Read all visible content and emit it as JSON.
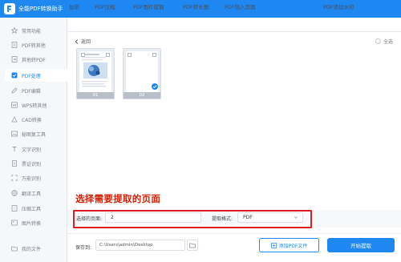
{
  "app": {
    "title": "全能PDF转换助手",
    "logo_icon": "pdf-logo-icon"
  },
  "colors": {
    "accent": "#1e87f0",
    "annotation": "#d81e06",
    "highlight_box": "#e02020"
  },
  "sidebar": {
    "items": [
      {
        "label": "常用功能",
        "icon": "star-icon",
        "active": false
      },
      {
        "label": "PDF转其他",
        "icon": "pdf-export-icon",
        "active": false
      },
      {
        "label": "其他转PDF",
        "icon": "pdf-import-icon",
        "active": false
      },
      {
        "label": "PDF处理",
        "icon": "pdf-process-icon",
        "active": true
      },
      {
        "label": "PDF编辑",
        "icon": "edit-icon",
        "active": false
      },
      {
        "label": "WPS转其他",
        "icon": "wps-icon",
        "active": false
      },
      {
        "label": "CAD转换",
        "icon": "cad-icon",
        "active": false
      },
      {
        "label": "秘图复工具",
        "icon": "image-icon",
        "active": false
      },
      {
        "label": "文字识别",
        "icon": "text-recognition-icon",
        "active": false
      },
      {
        "label": "票证识别",
        "icon": "receipt-icon",
        "active": false
      },
      {
        "label": "万能识别",
        "icon": "scan-icon",
        "active": false
      },
      {
        "label": "翻译工具",
        "icon": "translate-icon",
        "active": false
      },
      {
        "label": "压缩工具",
        "icon": "compress-icon",
        "active": false
      },
      {
        "label": "图片转换",
        "icon": "picture-icon",
        "active": false
      }
    ],
    "footer": {
      "label": "我的文件",
      "icon": "folder-icon"
    }
  },
  "tabs": [
    {
      "label": "加密",
      "active": false
    },
    {
      "label": "PDF压缩",
      "active": false
    },
    {
      "label": "PDF图片提取",
      "active": false
    },
    {
      "label": "PDF转长图",
      "active": false
    },
    {
      "label": "PDF插入页面",
      "active": false
    },
    {
      "label": "PDF页面提取",
      "active": true
    },
    {
      "label": "PDF添加水印",
      "active": false
    }
  ],
  "toolbar": {
    "back_label": "返回",
    "select_all_label": "全选"
  },
  "thumbnails": [
    {
      "page": "01",
      "selected": false
    },
    {
      "page": "02",
      "selected": true
    }
  ],
  "annotation": {
    "text": "选择需要提取的页面"
  },
  "settings": {
    "pages_label": "选择的页面:",
    "pages_value": "2",
    "format_label": "提取格式:",
    "format_value": "PDF"
  },
  "footer": {
    "save_label": "保存到:",
    "save_path": "C:\\Users\\admin\\Desktop",
    "add_file_label": "添加PDF文件",
    "start_label": "开始提取"
  }
}
